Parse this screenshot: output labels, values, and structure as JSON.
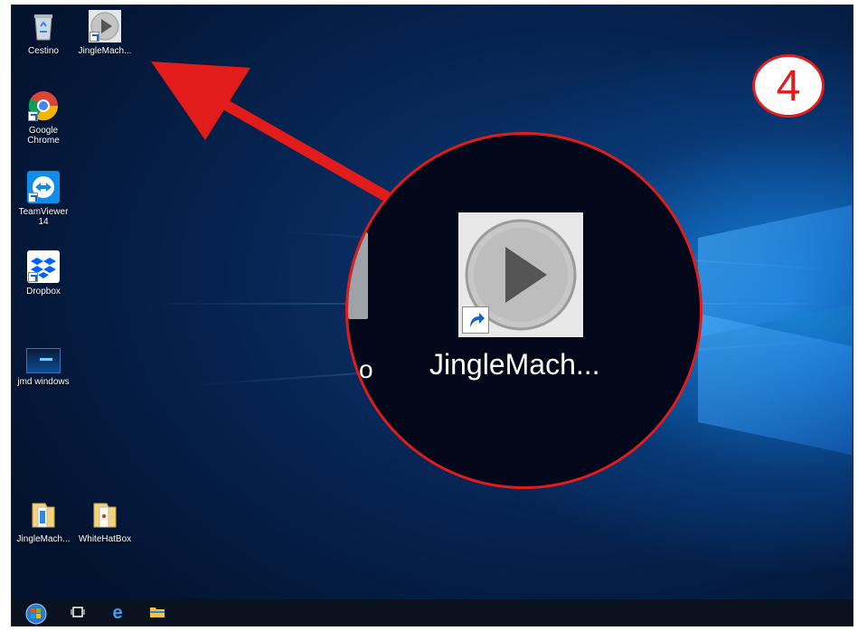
{
  "desktop": {
    "icons": [
      {
        "label": "Cestino",
        "icon": "recycle-bin-icon"
      },
      {
        "label": "JingleMach...",
        "icon": "play-icon"
      },
      {
        "label": "Google Chrome",
        "icon": "chrome-icon"
      },
      {
        "label": "TeamViewer 14",
        "icon": "teamviewer-icon"
      },
      {
        "label": "Dropbox",
        "icon": "dropbox-icon"
      },
      {
        "label": "jmd windows",
        "icon": "window-screenshot-icon"
      },
      {
        "label": "JingleMach...",
        "icon": "folder-icon"
      },
      {
        "label": "WhiteHatBox",
        "icon": "folder-icon"
      }
    ]
  },
  "zoom": {
    "label": "JingleMach...",
    "partial_label": "o"
  },
  "step_badge": "4",
  "taskbar": {
    "start": "start-orb-icon",
    "task_view": "task-view-icon",
    "edge": "edge-icon",
    "explorer": "file-explorer-icon"
  },
  "colors": {
    "annotation": "#e21b1b",
    "desktop_blue": "#0b3a78"
  }
}
